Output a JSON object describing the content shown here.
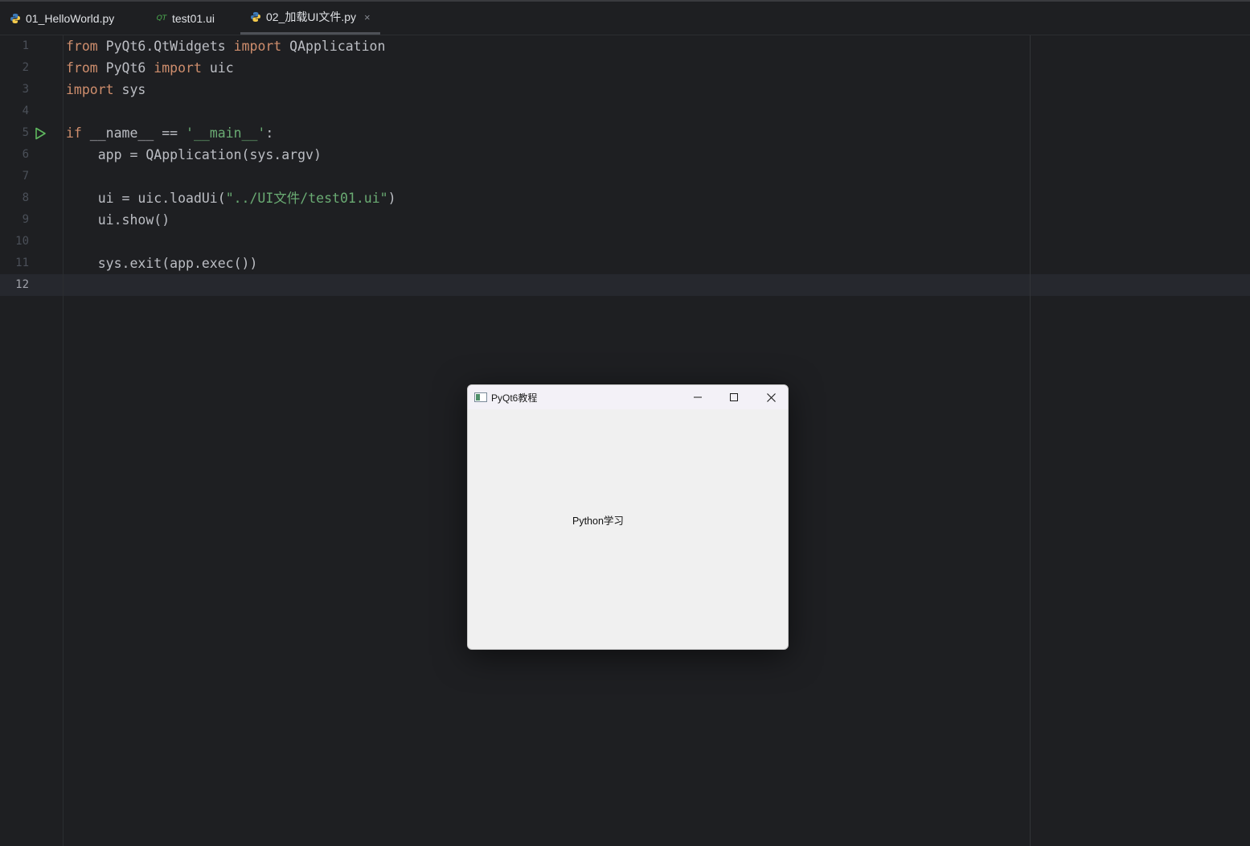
{
  "tabs": [
    {
      "label": "01_HelloWorld.py",
      "icon": "python-file-icon"
    },
    {
      "label": "test01.ui",
      "icon": "qt-ui-file-icon",
      "icon_text": "QT"
    },
    {
      "label": "02_加载UI文件.py",
      "icon": "python-file-icon",
      "active": true,
      "close": "×"
    }
  ],
  "editor": {
    "current_line": 12,
    "lines": [
      {
        "n": "1"
      },
      {
        "n": "2"
      },
      {
        "n": "3"
      },
      {
        "n": "4"
      },
      {
        "n": "5"
      },
      {
        "n": "6"
      },
      {
        "n": "7"
      },
      {
        "n": "8"
      },
      {
        "n": "9"
      },
      {
        "n": "10"
      },
      {
        "n": "11"
      },
      {
        "n": "12"
      }
    ],
    "tokens": {
      "l1": [
        "from",
        " PyQt6.QtWidgets ",
        "import",
        " QApplication"
      ],
      "l2": [
        "from",
        " PyQt6 ",
        "import",
        " uic"
      ],
      "l3": [
        "import",
        " sys"
      ],
      "l5": [
        "if",
        " __name__ == ",
        "'__main__'",
        ":"
      ],
      "l6": [
        "    app = QApplication(sys.argv)"
      ],
      "l8": [
        "    ui = uic.loadUi(",
        "\"../UI文件/test01.ui\"",
        ")"
      ],
      "l9": [
        "    ui.show()"
      ],
      "l11": [
        "    sys.exit(app.exec())"
      ]
    }
  },
  "qt_window": {
    "title": "PyQt6教程",
    "label": "Python学习",
    "controls": [
      "minimize-icon",
      "maximize-icon",
      "close-icon"
    ]
  },
  "colors": {
    "background": "#1e1f22",
    "keyword": "#cf8e6d",
    "string": "#6aab73",
    "text": "#bcbec4",
    "run_icon": "#5fb85f"
  }
}
